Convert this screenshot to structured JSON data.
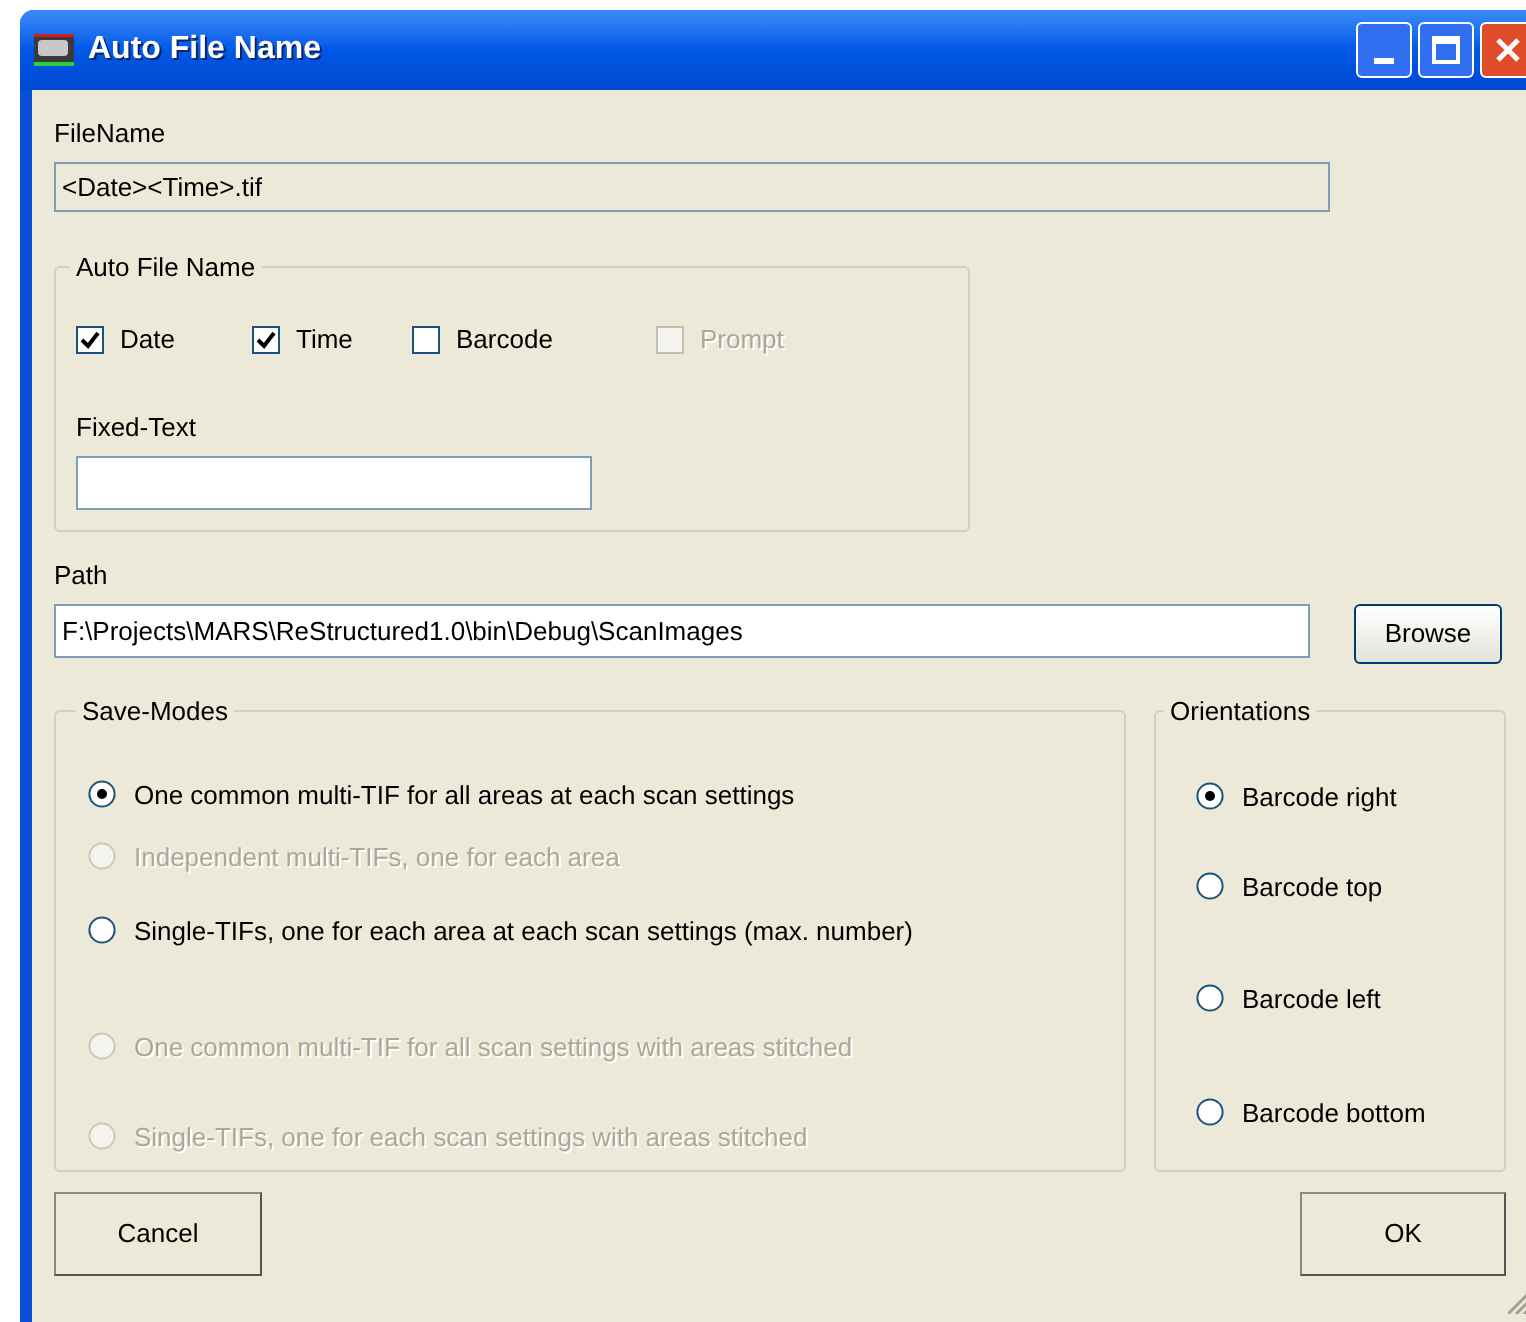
{
  "window": {
    "title": "Auto File Name"
  },
  "file_name": {
    "label": "FileName",
    "value": "<Date><Time>.tif"
  },
  "auto_file_name": {
    "title": "Auto File Name",
    "options": [
      {
        "label": "Date",
        "checked": true,
        "disabled": false
      },
      {
        "label": "Time",
        "checked": true,
        "disabled": false
      },
      {
        "label": "Barcode",
        "checked": false,
        "disabled": false
      },
      {
        "label": "Prompt",
        "checked": false,
        "disabled": true
      }
    ],
    "fixed_text": {
      "label": "Fixed-Text"
    }
  },
  "path": {
    "label": "Path",
    "value": "F:\\Projects\\MARS\\ReStructured1.0\\bin\\Debug\\ScanImages"
  },
  "browse_button": "Browse",
  "save_modes": {
    "title": "Save-Modes",
    "options": [
      {
        "label": "One common multi-TIF for all areas at each scan settings",
        "selected": true,
        "disabled": false
      },
      {
        "label": "Independent multi-TIFs, one for each area",
        "selected": false,
        "disabled": true
      },
      {
        "label": "Single-TIFs, one for each area at each scan settings (max. number)",
        "selected": false,
        "disabled": false
      },
      {
        "label": "One common multi-TIF for all scan settings with areas stitched",
        "selected": false,
        "disabled": true
      },
      {
        "label": "Single-TIFs, one for each scan settings with areas stitched",
        "selected": false,
        "disabled": true
      }
    ]
  },
  "orientations": {
    "title": "Orientations",
    "options": [
      {
        "label": "Barcode right",
        "selected": true
      },
      {
        "label": "Barcode top",
        "selected": false
      },
      {
        "label": "Barcode left",
        "selected": false
      },
      {
        "label": "Barcode bottom",
        "selected": false
      }
    ]
  },
  "buttons": {
    "cancel": "Cancel",
    "ok": "OK"
  }
}
